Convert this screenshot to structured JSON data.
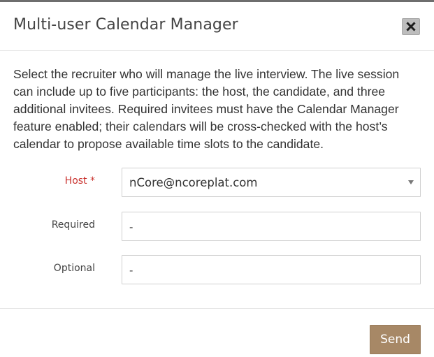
{
  "dialog": {
    "title": "Multi-user Calendar Manager",
    "close_icon": "close-icon"
  },
  "body": {
    "description": "Select the recruiter who will manage the live interview. The live session can include up to five participants: the host, the candidate, and three additional invitees. Required invitees must have the Calendar Manager feature enabled; their calendars will be cross-checked with the host’s calendar to propose available time slots to the candidate."
  },
  "form": {
    "host": {
      "label": "Host *",
      "selected_value": "nCore@ncoreplat.com"
    },
    "required": {
      "label": "Required",
      "value": "-"
    },
    "optional": {
      "label": "Optional",
      "value": "-"
    }
  },
  "footer": {
    "send_label": "Send"
  },
  "colors": {
    "accent_button": "#a78866",
    "required_label": "#c9302c",
    "close_button_bg": "#bdbdbd"
  }
}
